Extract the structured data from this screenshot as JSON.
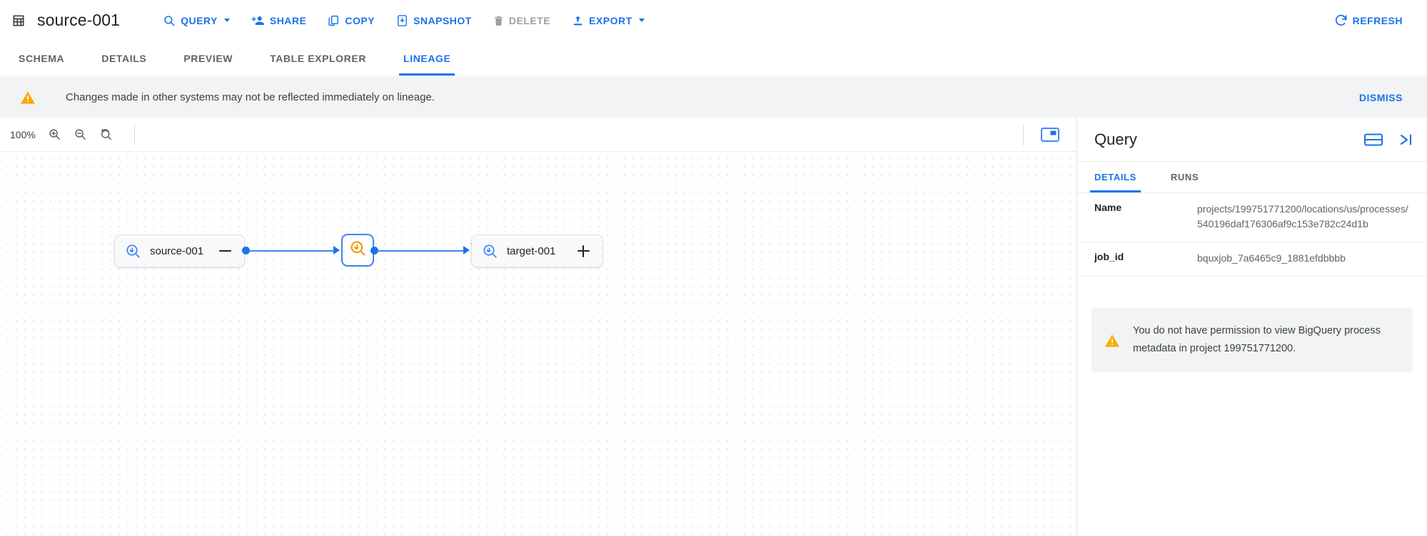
{
  "toolbar": {
    "table_icon": "table-icon",
    "title": "source-001",
    "actions": [
      {
        "id": "query",
        "label": "QUERY",
        "icon": "search-icon",
        "has_caret": true,
        "disabled": false
      },
      {
        "id": "share",
        "label": "SHARE",
        "icon": "person-add-icon",
        "has_caret": false,
        "disabled": false
      },
      {
        "id": "copy",
        "label": "COPY",
        "icon": "copy-icon",
        "has_caret": false,
        "disabled": false
      },
      {
        "id": "snapshot",
        "label": "SNAPSHOT",
        "icon": "snapshot-icon",
        "has_caret": false,
        "disabled": false
      },
      {
        "id": "delete",
        "label": "DELETE",
        "icon": "trash-icon",
        "has_caret": false,
        "disabled": true
      },
      {
        "id": "export",
        "label": "EXPORT",
        "icon": "upload-icon",
        "has_caret": true,
        "disabled": false
      }
    ],
    "refresh_label": "REFRESH",
    "refresh_icon": "refresh-icon",
    "accent_color": "#1a73e8",
    "disabled_color": "#9aa0a6"
  },
  "tabs": {
    "items": [
      {
        "id": "schema",
        "label": "SCHEMA",
        "active": false
      },
      {
        "id": "details",
        "label": "DETAILS",
        "active": false
      },
      {
        "id": "preview",
        "label": "PREVIEW",
        "active": false
      },
      {
        "id": "table-explorer",
        "label": "TABLE EXPLORER",
        "active": false
      },
      {
        "id": "lineage",
        "label": "LINEAGE",
        "active": true
      }
    ]
  },
  "banner": {
    "icon": "warning-triangle-icon",
    "icon_color": "#f9ab00",
    "message": "Changes made in other systems may not be reflected immediately on lineage.",
    "dismiss_label": "DISMISS",
    "background": "#f1f3f4"
  },
  "lineage": {
    "zoom_level": "100%",
    "controls": [
      {
        "id": "zoom-in",
        "icon": "zoom-in-icon"
      },
      {
        "id": "zoom-out",
        "icon": "zoom-out-icon"
      },
      {
        "id": "zoom-reset",
        "icon": "zoom-reset-icon"
      }
    ],
    "minimap_icon": "minimap-toggle-icon",
    "graph": {
      "nodes": [
        {
          "id": "source",
          "label": "source-001",
          "type": "table",
          "icon": "bigquery-table-icon",
          "toggle": "minus"
        },
        {
          "id": "process",
          "label": "",
          "type": "process",
          "icon": "bigquery-process-icon",
          "selected": true
        },
        {
          "id": "target",
          "label": "target-001",
          "type": "table",
          "icon": "bigquery-table-icon",
          "toggle": "plus"
        }
      ],
      "edges": [
        {
          "from": "source",
          "to": "process"
        },
        {
          "from": "process",
          "to": "target"
        }
      ],
      "edge_color": "#4285f4"
    }
  },
  "panel": {
    "title": "Query",
    "header_actions": [
      {
        "id": "split-pane",
        "icon": "split-pane-icon"
      },
      {
        "id": "collapse-panel",
        "icon": "collapse-right-icon"
      }
    ],
    "tabs": [
      {
        "id": "details",
        "label": "DETAILS",
        "active": true
      },
      {
        "id": "runs",
        "label": "RUNS",
        "active": false
      }
    ],
    "details": [
      {
        "key": "Name",
        "value": "projects/199751771200/locations/us/processes/540196daf176306af9c153e782c24d1b"
      },
      {
        "key": "job_id",
        "value": "bquxjob_7a6465c9_1881efdbbbb"
      }
    ],
    "permission_notice": {
      "icon": "warning-triangle-icon",
      "text": "You do not have permission to view BigQuery process metadata in project 199751771200."
    }
  }
}
